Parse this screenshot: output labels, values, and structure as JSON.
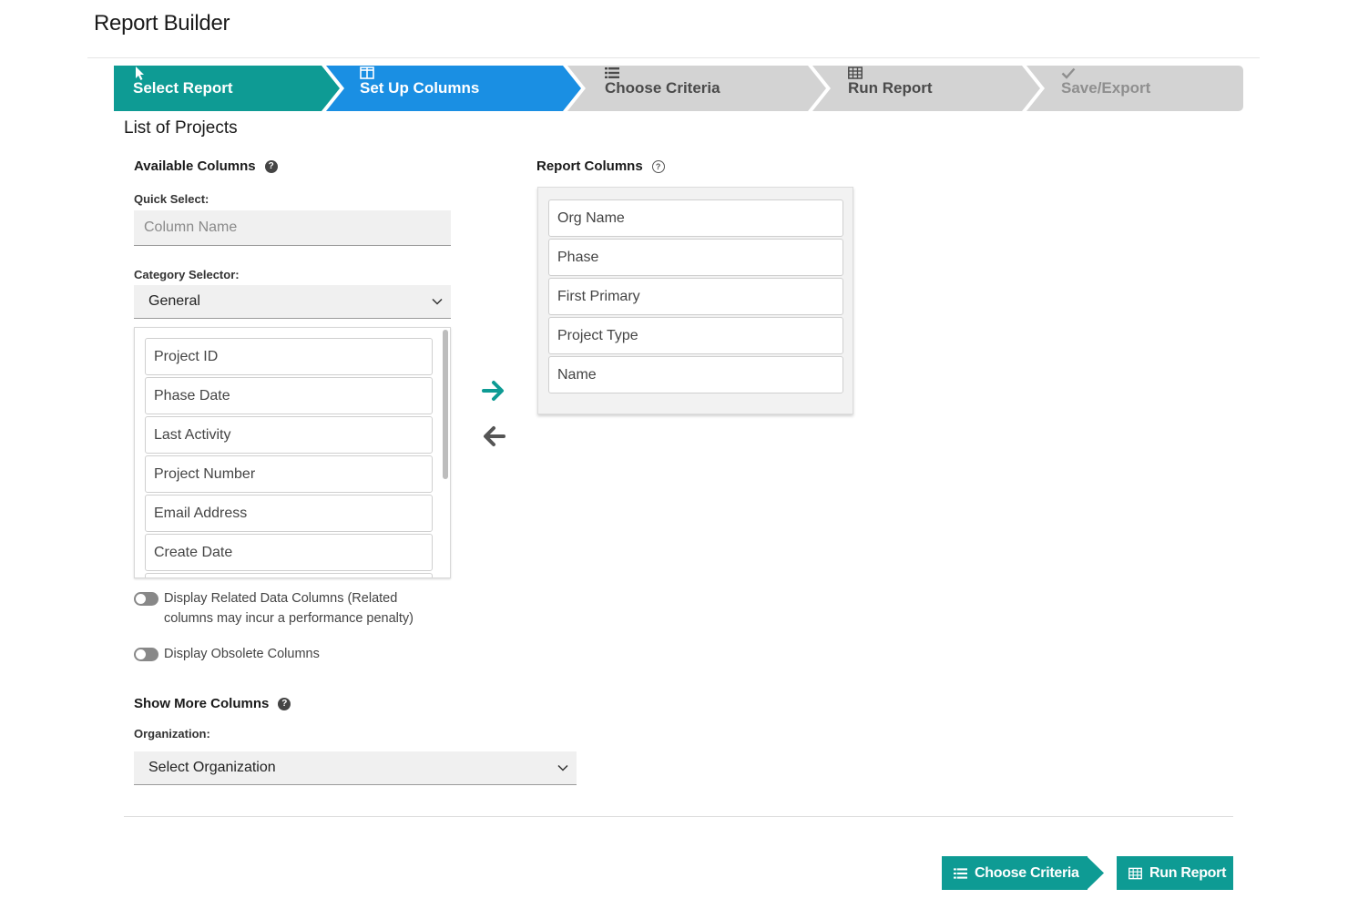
{
  "page": {
    "title": "Report Builder",
    "report_name": "List of Projects"
  },
  "wizard": {
    "steps": [
      {
        "label": "Select Report",
        "icon": "cursor-pointer-icon",
        "state": "completed",
        "color": "#0e9b94"
      },
      {
        "label": "Set Up Columns",
        "icon": "columns-icon",
        "state": "active",
        "color": "#1a8fe3"
      },
      {
        "label": "Choose Criteria",
        "icon": "list-icon",
        "state": "pending",
        "color": "#d3d3d3"
      },
      {
        "label": "Run Report",
        "icon": "table-icon",
        "state": "pending",
        "color": "#d3d3d3"
      },
      {
        "label": "Save/Export",
        "icon": "check-icon",
        "state": "disabled",
        "color": "#d3d3d3"
      }
    ]
  },
  "available": {
    "heading": "Available Columns",
    "quick_select_label": "Quick Select:",
    "quick_select_placeholder": "Column Name",
    "category_label": "Category Selector:",
    "category_value": "General",
    "items": [
      "Project ID",
      "Phase Date",
      "Last Activity",
      "Project Number",
      "Email Address",
      "Create Date"
    ]
  },
  "report": {
    "heading": "Report Columns",
    "items": [
      "Org Name",
      "Phase",
      "First Primary",
      "Project Type",
      "Name"
    ]
  },
  "transfer": {
    "add_icon": "arrow-right-icon",
    "remove_icon": "arrow-left-icon",
    "add_color": "#0e9b94",
    "remove_color": "#555555"
  },
  "toggles": {
    "related_line1": "Display Related Data Columns (Related",
    "related_line2": "columns may incur a performance penalty)",
    "obsolete": "Display Obsolete Columns"
  },
  "more": {
    "heading": "Show More Columns",
    "org_label": "Organization:",
    "org_value": "Select Organization"
  },
  "footer": {
    "criteria_button": "Choose Criteria",
    "run_button": "Run Report"
  }
}
